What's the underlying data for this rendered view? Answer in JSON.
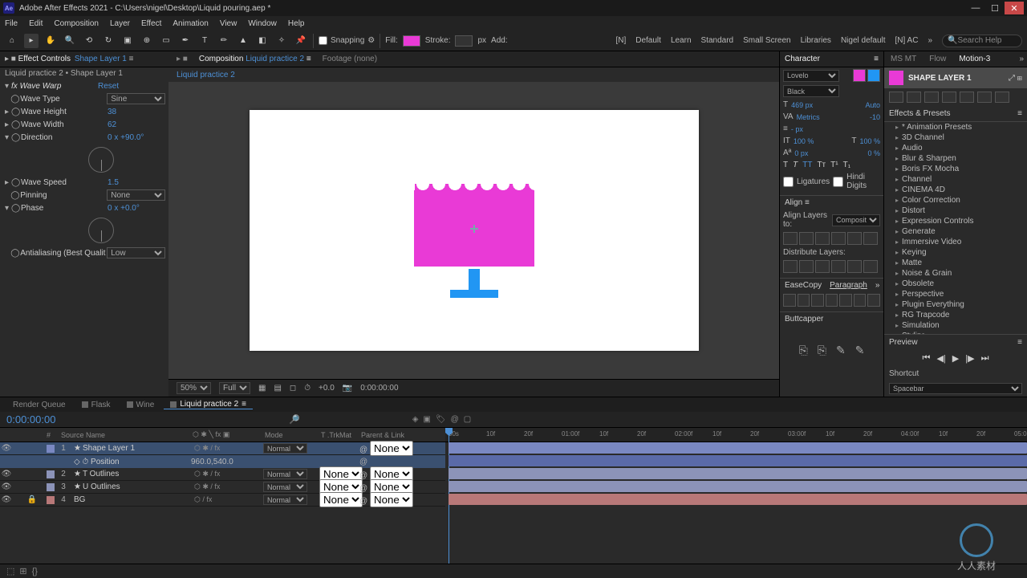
{
  "title": "Adobe After Effects 2021 - C:\\Users\\nigel\\Desktop\\Liquid pouring.aep *",
  "app_icon": "Ae",
  "menu": [
    "File",
    "Edit",
    "Composition",
    "Layer",
    "Effect",
    "Animation",
    "View",
    "Window",
    "Help"
  ],
  "toolbar": {
    "snapping": "Snapping",
    "fill": "Fill:",
    "fill_color": "#e93ad6",
    "stroke": "Stroke:",
    "stroke_px": "px",
    "add": "Add:",
    "workspaces": [
      "[N]",
      "Default",
      "Learn",
      "Standard",
      "Small Screen",
      "Libraries",
      "Nigel default",
      "[N] AC"
    ],
    "search": "Search Help"
  },
  "effect_controls": {
    "tab": "Effect Controls",
    "layer": "Shape Layer 1",
    "breadcrumb": "Liquid practice 2 • Shape Layer 1",
    "fx_name": "Wave Warp",
    "reset": "Reset",
    "props": {
      "wave_type": {
        "label": "Wave Type",
        "val": "Sine"
      },
      "wave_height": {
        "label": "Wave Height",
        "val": "38"
      },
      "wave_width": {
        "label": "Wave Width",
        "val": "62"
      },
      "direction": {
        "label": "Direction",
        "val": "0 x +90.0°"
      },
      "wave_speed": {
        "label": "Wave Speed",
        "val": "1.5"
      },
      "pinning": {
        "label": "Pinning",
        "val": "None"
      },
      "phase": {
        "label": "Phase",
        "val": "0 x +0.0°"
      },
      "antialias": {
        "label": "Antialiasing (Best Qualit",
        "val": "Low"
      }
    }
  },
  "composition": {
    "tab_label": "Composition",
    "name": "Liquid practice 2",
    "footage": "Footage (none)",
    "footer": {
      "zoom": "50%",
      "res": "Full",
      "time": "0:00:00:00",
      "rot": "+0.0"
    }
  },
  "character": {
    "hdr": "Character",
    "font": "Lovelo",
    "style": "Black",
    "fill": "#e93ad6",
    "stroke": "#2196f3",
    "size": "469 px",
    "leading": "Auto",
    "tracking": "-10",
    "scale_h": "100 %",
    "scale_v": "100 %",
    "baseline1": "0 px",
    "baseline2": "0 %",
    "ligatures": "Ligatures",
    "hindi": "Hindi Digits",
    "align_hdr": "Align",
    "align_to": "Align Layers to:",
    "align_target": "Composition",
    "dist": "Distribute Layers:",
    "easecopy": "EaseCopy",
    "paragraph": "Paragraph",
    "buttcapper": "Buttcapper"
  },
  "right": {
    "tabs": [
      "MS MT",
      "Flow",
      "Motion-3"
    ],
    "shape_layer": "SHAPE LAYER 1",
    "fx_hdr": "Effects & Presets",
    "categories": [
      "* Animation Presets",
      "3D Channel",
      "Audio",
      "Blur & Sharpen",
      "Boris FX Mocha",
      "Channel",
      "CINEMA 4D",
      "Color Correction",
      "Distort",
      "Expression Controls",
      "Generate",
      "Immersive Video",
      "Keying",
      "Matte",
      "Noise & Grain",
      "Obsolete",
      "Perspective",
      "Plugin Everything",
      "RG Trapcode",
      "Simulation",
      "Stylize"
    ],
    "preview": "Preview",
    "shortcut": "Shortcut",
    "shortcut_val": "Spacebar"
  },
  "timeline": {
    "tabs": [
      {
        "label": "Render Queue"
      },
      {
        "label": "Flask"
      },
      {
        "label": "Wine"
      },
      {
        "label": "Liquid practice 2",
        "active": true
      }
    ],
    "timecode": "0:00:00:00",
    "cols": {
      "source": "Source Name",
      "mode": "Mode",
      "trkmat": "T .TrkMat",
      "parent": "Parent & Link"
    },
    "layers": [
      {
        "num": "1",
        "name": "Shape Layer 1",
        "color": "#7a88c2",
        "sel": true,
        "mode": "Normal",
        "parent": "None",
        "star": true
      },
      {
        "num": "",
        "name": "Position",
        "pos": "960.0,540.0",
        "prop": true,
        "sel": true
      },
      {
        "num": "2",
        "name": "T Outlines",
        "color": "#8c93b8",
        "mode": "Normal",
        "trk": "None",
        "parent": "None",
        "star": true
      },
      {
        "num": "3",
        "name": "U Outlines",
        "color": "#8c93b8",
        "mode": "Normal",
        "trk": "None",
        "parent": "None",
        "star": true
      },
      {
        "num": "4",
        "name": "BG",
        "color": "#b87878",
        "mode": "Normal",
        "trk": "None",
        "parent": "None"
      }
    ],
    "ruler": [
      "00s",
      "10f",
      "20f",
      "01:00f",
      "10f",
      "20f",
      "02:00f",
      "10f",
      "20f",
      "03:00f",
      "10f",
      "20f",
      "04:00f",
      "10f",
      "20f",
      "05:0"
    ]
  },
  "watermark": "人人素材"
}
